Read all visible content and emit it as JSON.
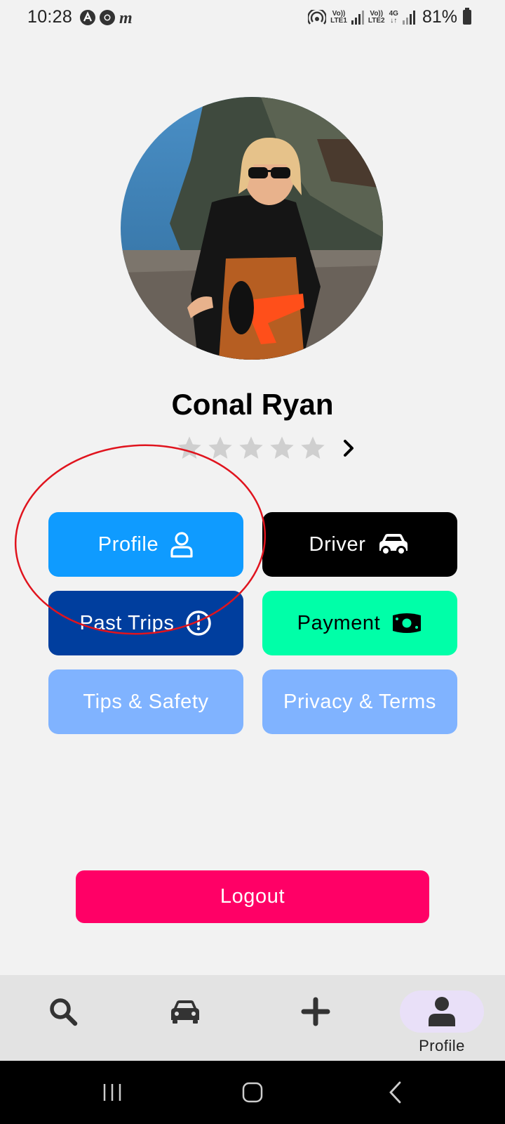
{
  "status_bar": {
    "time": "10:28",
    "network_1": [
      "Vo))",
      "LTE1"
    ],
    "network_2": [
      "Vo))",
      "LTE2"
    ],
    "network_type": "4G",
    "battery": "81%"
  },
  "profile": {
    "name": "Conal Ryan",
    "rating_stars_filled": 0,
    "rating_stars_total": 5
  },
  "menu": {
    "profile_label": "Profile",
    "driver_label": "Driver",
    "past_trips_label": "Past Trips",
    "payment_label": "Payment",
    "tips_label": "Tips & Safety",
    "privacy_label": "Privacy & Terms"
  },
  "logout_label": "Logout",
  "bottom_nav": {
    "items": [
      {
        "icon": "search-icon",
        "label": ""
      },
      {
        "icon": "car-icon",
        "label": ""
      },
      {
        "icon": "plus-icon",
        "label": ""
      },
      {
        "icon": "person-icon",
        "label": "Profile",
        "active": true
      }
    ]
  },
  "colors": {
    "profile_button": "#0f9bff",
    "driver_button": "#000000",
    "past_trips_button": "#003e9e",
    "payment_button": "#00ffa8",
    "tips_button": "#80b3ff",
    "privacy_button": "#80b3ff",
    "logout_button": "#ff0066",
    "annotation": "#e0141e"
  }
}
